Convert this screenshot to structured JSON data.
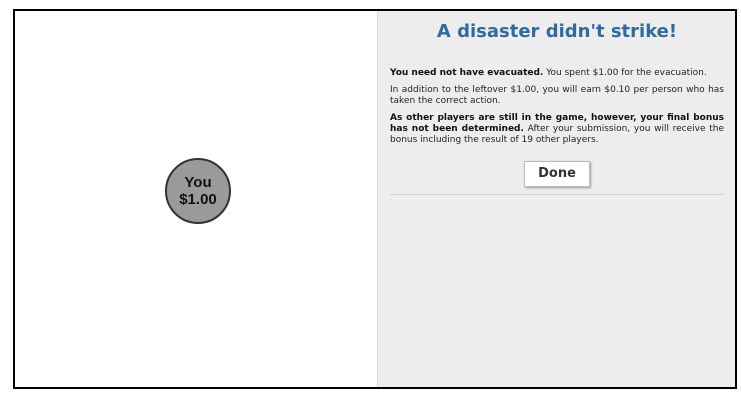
{
  "player": {
    "name": "You",
    "amount": "$1.00"
  },
  "result": {
    "title": "A disaster didn't strike!",
    "p1_bold": "You need not have evacuated.",
    "p1_text": " You spent $1.00 for the evacuation.",
    "p2_text": "In addition to the leftover $1.00, you will earn $0.10 per person who has taken the correct action.",
    "p3_bold": "As other players are still in the game, however, your final bonus has not been determined.",
    "p3_text": " After your submission, you will receive the bonus including the result of 19 other players.",
    "done_label": "Done"
  },
  "colors": {
    "title": "#2e6aa3",
    "right_pane_bg": "#ededed",
    "node_fill": "#9a9a9a"
  }
}
